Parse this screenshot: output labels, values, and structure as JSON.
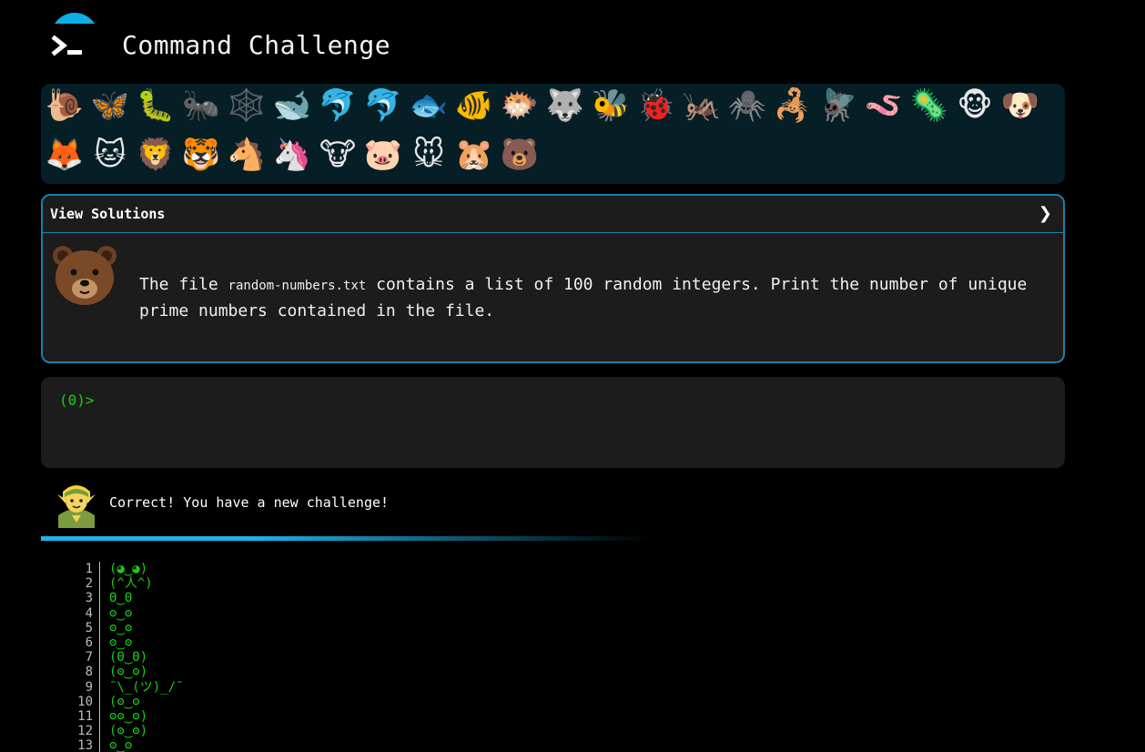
{
  "header": {
    "title": "Command Challenge",
    "logo_icon": "terminal-prompt-icon",
    "accent_color": "#10aee6"
  },
  "animals": {
    "row1": [
      "🐌",
      "🦋",
      "🐛",
      "🐜",
      "🕸️",
      "🐋",
      "🐬",
      "🐬",
      "🐟",
      "🐠",
      "🐡",
      "🐺",
      "🐝",
      "🐞",
      "🦗",
      "🕷️",
      "🦂",
      "🪰",
      "🪱",
      "🦠",
      "🐵",
      "🐶"
    ],
    "row2": [
      "🦊",
      "🐱",
      "🦁",
      "🐯",
      "🐴",
      "🦄",
      "🐮",
      "🐷",
      "🐭",
      "🐹",
      "🐻"
    ]
  },
  "solutions": {
    "label": "View Solutions",
    "chevron": "❯",
    "avatar": "bear-face-icon",
    "text_before": "The file",
    "filename": "random-numbers.txt",
    "text_after": "contains a list of 100 random integers. Print the number of unique prime numbers contained in the file."
  },
  "terminal": {
    "prompt": "(0)>",
    "value": ""
  },
  "status": {
    "avatar": "elf-icon",
    "message": "Correct! You have a new challenge!"
  },
  "output": {
    "lines": [
      {
        "n": "1",
        "text": "(◕‿◕)"
      },
      {
        "n": "2",
        "text": "(^人^)"
      },
      {
        "n": "3",
        "text": "Θ‿Θ"
      },
      {
        "n": "4",
        "text": "ʘ‿ʘ"
      },
      {
        "n": "5",
        "text": "ʘ‿ʘ"
      },
      {
        "n": "6",
        "text": "ʘ‿ʘ"
      },
      {
        "n": "7",
        "text": "(Θ‿Θ)"
      },
      {
        "n": "8",
        "text": "(ʘ‿ʘ)"
      },
      {
        "n": "9",
        "text": "¯\\_(ツ)_/¯"
      },
      {
        "n": "10",
        "text": "(ʘ‿ʘ"
      },
      {
        "n": "11",
        "text": "ʘʘ‿ʘ)"
      },
      {
        "n": "12",
        "text": "(ʘ‿ʘ)"
      },
      {
        "n": "13",
        "text": "ʘ‿ʘ"
      }
    ],
    "text_color": "#16d016"
  }
}
